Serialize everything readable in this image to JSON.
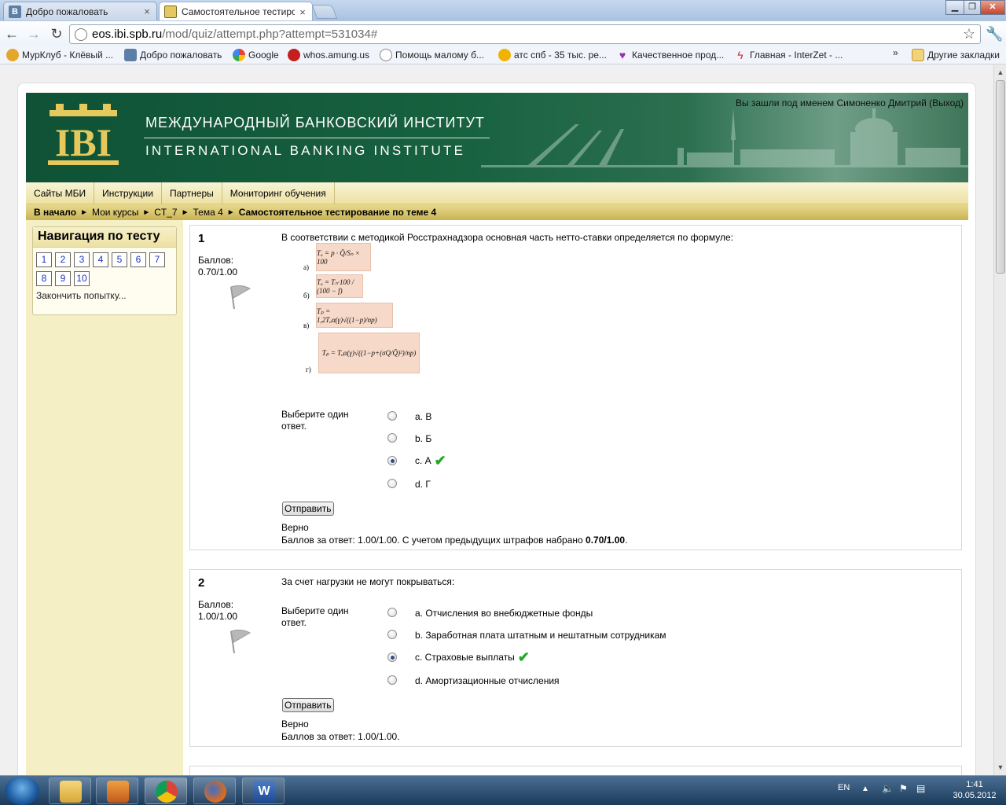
{
  "browser": {
    "tabs": [
      {
        "title": "Добро пожаловать",
        "active": false
      },
      {
        "title": "Самостоятельное тестиро",
        "active": true
      }
    ],
    "url_host": "eos.ibi.spb.ru",
    "url_path": "/mod/quiz/attempt.php?attempt=531034#",
    "bookmarks": [
      "МурКлуб - Клёвый ...",
      "Добро пожаловать",
      "Google",
      "whos.amung.us",
      "Помощь малому б...",
      "атс спб - 35 тыс. ре...",
      "Качественное прод...",
      "Главная - InterZet - ...",
      "»",
      "Другие закладки"
    ]
  },
  "site": {
    "org_ru": "МЕЖДУНАРОДНЫЙ БАНКОВСКИЙ ИНСТИТУТ",
    "org_en": "INTERNATIONAL BANKING INSTITUTE",
    "logo_text": "IBI",
    "login": "Вы зашли под именем Симоненко Дмитрий (Выход)",
    "menu": [
      "Сайты МБИ",
      "Инструкции",
      "Партнеры",
      "Мониторинг обучения"
    ],
    "breadcrumb": [
      "В начало",
      "Мои курсы",
      "CT_7",
      "Тема 4",
      "Самостоятельное тестирование по теме 4"
    ],
    "breadcrumb_sep": "►"
  },
  "nav": {
    "title": "Навигация по тесту",
    "questions": [
      "1",
      "2",
      "3",
      "4",
      "5",
      "6",
      "7",
      "8",
      "9",
      "10"
    ],
    "finish": "Закончить попытку..."
  },
  "questions": [
    {
      "number": "1",
      "score_label": "Баллов:",
      "score": "0.70/1.00",
      "text": "В соответствии с методикой Росстрахнадзора основная часть нетто-ставки определяется по формуле:",
      "formulas": [
        {
          "label": "а)",
          "expr": "Tₒ = p · Q̄/Sₙ × 100"
        },
        {
          "label": "б)",
          "expr": "Tₒ = Tₙ·100 / (100 − f)"
        },
        {
          "label": "в)",
          "expr": "Tₚ = 1,2Tₒα(γ)√((1−p)/np)"
        },
        {
          "label": "г)",
          "expr": "Tₚ = Tₒα(γ)√((1−p+(σQ/Q̄)²)/np)"
        }
      ],
      "prompt": "Выберите один ответ.",
      "options": [
        {
          "text": "a. В",
          "checked": false,
          "correct": false
        },
        {
          "text": "b. Б",
          "checked": false,
          "correct": false
        },
        {
          "text": "c. А",
          "checked": true,
          "correct": true
        },
        {
          "text": "d. Г",
          "checked": false,
          "correct": false
        }
      ],
      "submit": "Отправить",
      "status": "Верно",
      "feedback_prefix": "Баллов за ответ: 1.00/1.00. С учетом предыдущих штрафов набрано ",
      "feedback_bold": "0.70/1.00",
      "feedback_suffix": "."
    },
    {
      "number": "2",
      "score_label": "Баллов:",
      "score": "1.00/1.00",
      "text": "За счет нагрузки не могут покрываться:",
      "prompt": "Выберите один ответ.",
      "options": [
        {
          "text": "a. Отчисления во внебюджетные фонды",
          "checked": false,
          "correct": false
        },
        {
          "text": "b. Заработная плата штатным и нештатным сотрудникам",
          "checked": false,
          "correct": false
        },
        {
          "text": "c. Страховые выплаты",
          "checked": true,
          "correct": true
        },
        {
          "text": "d. Амортизационные отчисления",
          "checked": false,
          "correct": false
        }
      ],
      "submit": "Отправить",
      "status": "Верно",
      "feedback": "Баллов за ответ: 1.00/1.00."
    }
  ],
  "check_mark": "✔",
  "taskbar": {
    "lang": "EN",
    "time": "1:41",
    "date": "30.05.2012"
  },
  "colors": {
    "banner_green": "#17613f",
    "menu_gold": "#ede1a4",
    "left_column": "#f4efc5",
    "link_blue": "#1d32c6",
    "correct_green": "#22a826"
  }
}
